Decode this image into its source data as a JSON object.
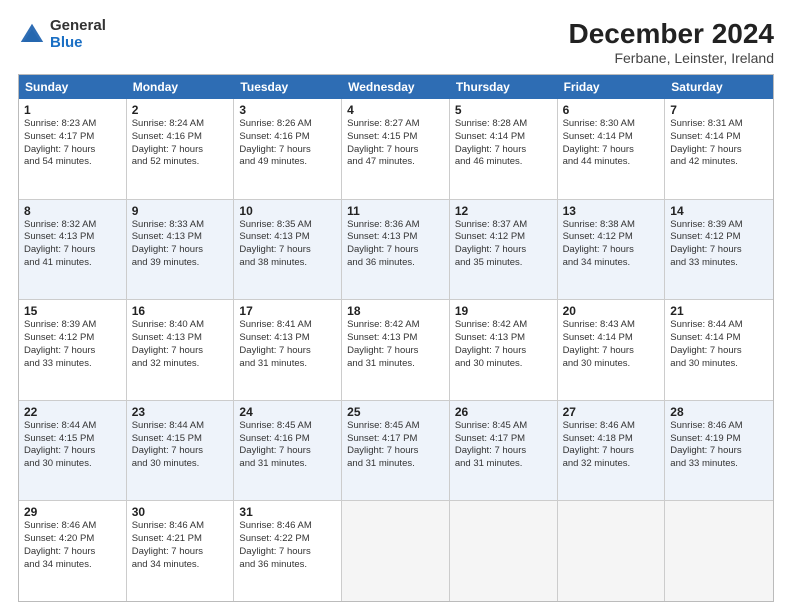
{
  "logo": {
    "general": "General",
    "blue": "Blue"
  },
  "title": "December 2024",
  "subtitle": "Ferbane, Leinster, Ireland",
  "days": [
    "Sunday",
    "Monday",
    "Tuesday",
    "Wednesday",
    "Thursday",
    "Friday",
    "Saturday"
  ],
  "weeks": [
    [
      {
        "day": 1,
        "info": "Sunrise: 8:23 AM\nSunset: 4:17 PM\nDaylight: 7 hours\nand 54 minutes."
      },
      {
        "day": 2,
        "info": "Sunrise: 8:24 AM\nSunset: 4:16 PM\nDaylight: 7 hours\nand 52 minutes."
      },
      {
        "day": 3,
        "info": "Sunrise: 8:26 AM\nSunset: 4:16 PM\nDaylight: 7 hours\nand 49 minutes."
      },
      {
        "day": 4,
        "info": "Sunrise: 8:27 AM\nSunset: 4:15 PM\nDaylight: 7 hours\nand 47 minutes."
      },
      {
        "day": 5,
        "info": "Sunrise: 8:28 AM\nSunset: 4:14 PM\nDaylight: 7 hours\nand 46 minutes."
      },
      {
        "day": 6,
        "info": "Sunrise: 8:30 AM\nSunset: 4:14 PM\nDaylight: 7 hours\nand 44 minutes."
      },
      {
        "day": 7,
        "info": "Sunrise: 8:31 AM\nSunset: 4:14 PM\nDaylight: 7 hours\nand 42 minutes."
      }
    ],
    [
      {
        "day": 8,
        "info": "Sunrise: 8:32 AM\nSunset: 4:13 PM\nDaylight: 7 hours\nand 41 minutes."
      },
      {
        "day": 9,
        "info": "Sunrise: 8:33 AM\nSunset: 4:13 PM\nDaylight: 7 hours\nand 39 minutes."
      },
      {
        "day": 10,
        "info": "Sunrise: 8:35 AM\nSunset: 4:13 PM\nDaylight: 7 hours\nand 38 minutes."
      },
      {
        "day": 11,
        "info": "Sunrise: 8:36 AM\nSunset: 4:13 PM\nDaylight: 7 hours\nand 36 minutes."
      },
      {
        "day": 12,
        "info": "Sunrise: 8:37 AM\nSunset: 4:12 PM\nDaylight: 7 hours\nand 35 minutes."
      },
      {
        "day": 13,
        "info": "Sunrise: 8:38 AM\nSunset: 4:12 PM\nDaylight: 7 hours\nand 34 minutes."
      },
      {
        "day": 14,
        "info": "Sunrise: 8:39 AM\nSunset: 4:12 PM\nDaylight: 7 hours\nand 33 minutes."
      }
    ],
    [
      {
        "day": 15,
        "info": "Sunrise: 8:39 AM\nSunset: 4:12 PM\nDaylight: 7 hours\nand 33 minutes."
      },
      {
        "day": 16,
        "info": "Sunrise: 8:40 AM\nSunset: 4:13 PM\nDaylight: 7 hours\nand 32 minutes."
      },
      {
        "day": 17,
        "info": "Sunrise: 8:41 AM\nSunset: 4:13 PM\nDaylight: 7 hours\nand 31 minutes."
      },
      {
        "day": 18,
        "info": "Sunrise: 8:42 AM\nSunset: 4:13 PM\nDaylight: 7 hours\nand 31 minutes."
      },
      {
        "day": 19,
        "info": "Sunrise: 8:42 AM\nSunset: 4:13 PM\nDaylight: 7 hours\nand 30 minutes."
      },
      {
        "day": 20,
        "info": "Sunrise: 8:43 AM\nSunset: 4:14 PM\nDaylight: 7 hours\nand 30 minutes."
      },
      {
        "day": 21,
        "info": "Sunrise: 8:44 AM\nSunset: 4:14 PM\nDaylight: 7 hours\nand 30 minutes."
      }
    ],
    [
      {
        "day": 22,
        "info": "Sunrise: 8:44 AM\nSunset: 4:15 PM\nDaylight: 7 hours\nand 30 minutes."
      },
      {
        "day": 23,
        "info": "Sunrise: 8:44 AM\nSunset: 4:15 PM\nDaylight: 7 hours\nand 30 minutes."
      },
      {
        "day": 24,
        "info": "Sunrise: 8:45 AM\nSunset: 4:16 PM\nDaylight: 7 hours\nand 31 minutes."
      },
      {
        "day": 25,
        "info": "Sunrise: 8:45 AM\nSunset: 4:17 PM\nDaylight: 7 hours\nand 31 minutes."
      },
      {
        "day": 26,
        "info": "Sunrise: 8:45 AM\nSunset: 4:17 PM\nDaylight: 7 hours\nand 31 minutes."
      },
      {
        "day": 27,
        "info": "Sunrise: 8:46 AM\nSunset: 4:18 PM\nDaylight: 7 hours\nand 32 minutes."
      },
      {
        "day": 28,
        "info": "Sunrise: 8:46 AM\nSunset: 4:19 PM\nDaylight: 7 hours\nand 33 minutes."
      }
    ],
    [
      {
        "day": 29,
        "info": "Sunrise: 8:46 AM\nSunset: 4:20 PM\nDaylight: 7 hours\nand 34 minutes."
      },
      {
        "day": 30,
        "info": "Sunrise: 8:46 AM\nSunset: 4:21 PM\nDaylight: 7 hours\nand 34 minutes."
      },
      {
        "day": 31,
        "info": "Sunrise: 8:46 AM\nSunset: 4:22 PM\nDaylight: 7 hours\nand 36 minutes."
      },
      null,
      null,
      null,
      null
    ]
  ]
}
